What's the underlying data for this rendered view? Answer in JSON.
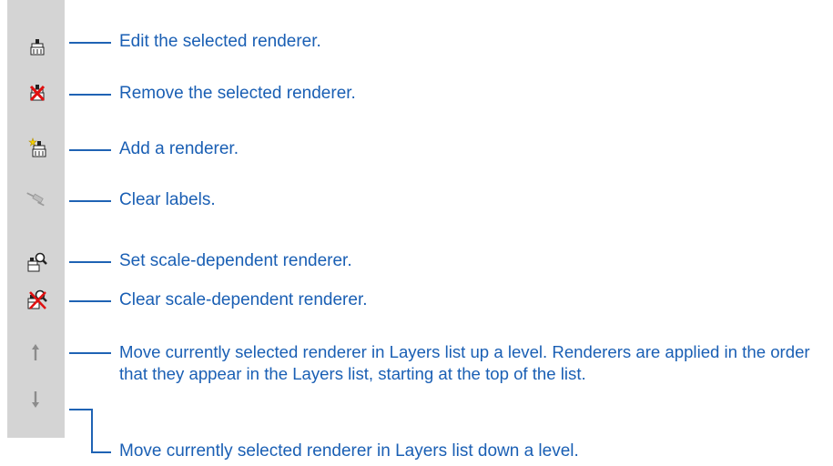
{
  "toolbar": {
    "buttons": [
      {
        "name": "edit-renderer-button",
        "icon": "paint-brush-icon",
        "label": "Edit the selected renderer."
      },
      {
        "name": "remove-renderer-button",
        "icon": "remove-brush-icon",
        "label": "Remove the selected renderer."
      },
      {
        "name": "add-renderer-button",
        "icon": "add-brush-icon",
        "label": "Add a renderer."
      },
      {
        "name": "clear-labels-button",
        "icon": "clear-labels-icon",
        "label": "Clear labels."
      },
      {
        "name": "set-scale-dependent-button",
        "icon": "brush-magnifier-icon",
        "label": "Set scale-dependent renderer."
      },
      {
        "name": "clear-scale-dependent-button",
        "icon": "brush-magnifier-x-icon",
        "label": "Clear scale-dependent renderer."
      },
      {
        "name": "move-up-button",
        "icon": "arrow-up-icon",
        "label": "Move currently selected renderer in Layers list up a level. Renderers are applied in the order that they appear in the Layers list, starting at the top of the list."
      },
      {
        "name": "move-down-button",
        "icon": "arrow-down-icon",
        "label": "Move currently selected renderer in Layers list down a level."
      }
    ]
  },
  "colors": {
    "callout": "#1a5fb4",
    "leader": "#1f63b4",
    "toolbar_bg": "#d4d4d4"
  }
}
